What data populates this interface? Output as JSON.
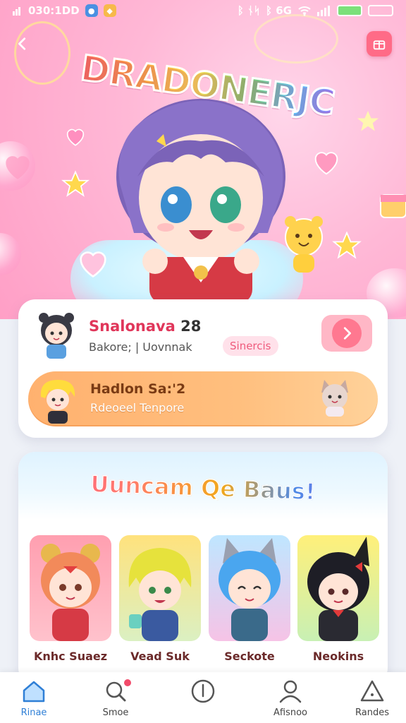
{
  "status_bar": {
    "time": "030:1DD",
    "right_text_1": "ᛒ ᚾᛋ",
    "right_text_2": "ᛒ 6G"
  },
  "hero": {
    "game_title": "DRADONERJC"
  },
  "profile": {
    "player_name": "Snalonava",
    "player_level": "28",
    "meta": "Bakore; | Uovnnak",
    "status_tag": "Sinercis"
  },
  "friend": {
    "name": "Hadlon Sa:'2",
    "subtitle": "Rdeoeel Tenpore"
  },
  "characters_section": {
    "title": "Uuncam Qe Baus!",
    "characters": [
      {
        "name": "Knhc Suaez"
      },
      {
        "name": "Vead Suk"
      },
      {
        "name": "Seckote"
      },
      {
        "name": "Neokins"
      }
    ]
  },
  "bottom_nav": [
    {
      "label": "Rinae"
    },
    {
      "label": "Smoe"
    },
    {
      "label": ""
    },
    {
      "label": "Afisnoo"
    },
    {
      "label": "Randes"
    }
  ],
  "colors": {
    "accent_pink": "#ff6b87",
    "name_red": "#e0365a",
    "banner_orange": "#ffb16f",
    "nav_active": "#2f7fd6"
  }
}
